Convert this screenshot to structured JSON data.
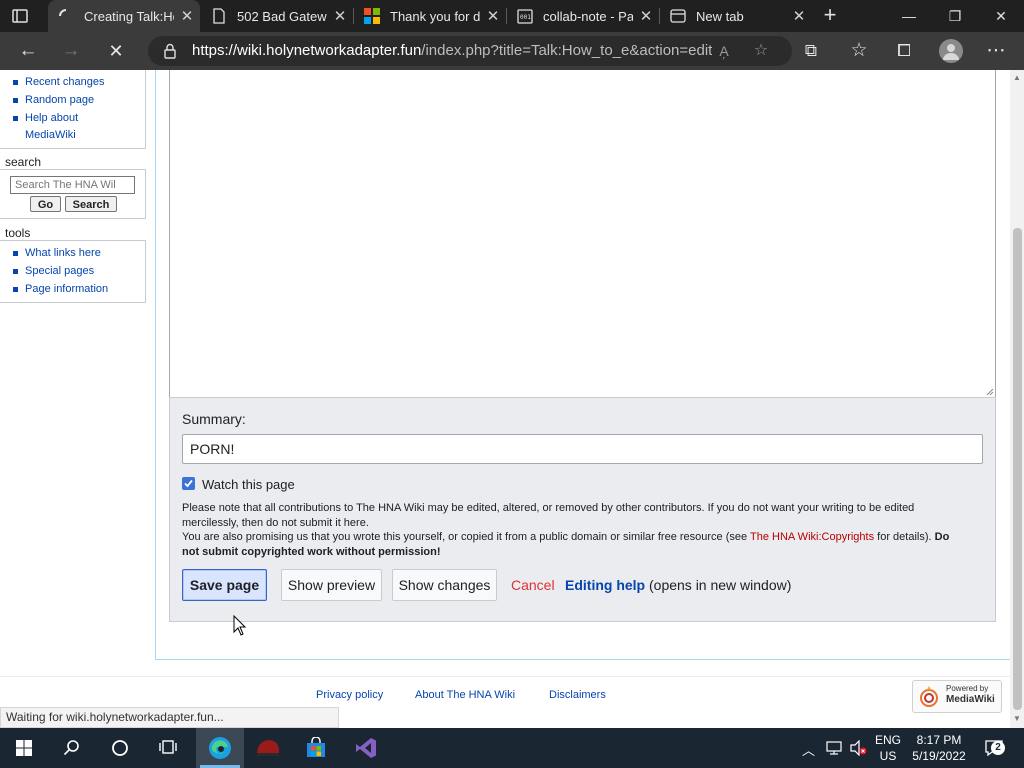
{
  "browser": {
    "tabs": [
      {
        "title": "Creating Talk:Ho",
        "active": true,
        "icon": "loading-spinner-icon"
      },
      {
        "title": "502 Bad Gatewa",
        "active": false,
        "icon": "page-icon"
      },
      {
        "title": "Thank you for d",
        "active": false,
        "icon": "microsoft-logo-icon"
      },
      {
        "title": "collab-note - Pa",
        "active": false,
        "icon": "binary-note-icon"
      },
      {
        "title": "New tab",
        "active": false,
        "icon": "new-tab-page-icon"
      }
    ],
    "url_host": "https://wiki.holynetworkadapter.fun",
    "url_path": "/index.php?title=Talk:How_to_e&action=edit..."
  },
  "sidebar": {
    "navigation_items": [
      "Recent changes",
      "Random page",
      "Help about",
      "MediaWiki"
    ],
    "search": {
      "heading": "search",
      "placeholder": "Search The HNA Wil",
      "go_label": "Go",
      "search_label": "Search"
    },
    "tools": {
      "heading": "tools",
      "items": [
        "What links here",
        "Special pages",
        "Page information"
      ]
    }
  },
  "editor": {
    "summary_label": "Summary:",
    "summary_value": "PORN!",
    "watch_label": "Watch this page",
    "watch_checked": true,
    "notice_line1": "Please note that all contributions to The HNA Wiki may be edited, altered, or removed by other contributors. If you do not want your writing to be edited",
    "notice_line2": "mercilessly, then do not submit it here.",
    "notice_line3_pre": "You are also promising us that you wrote this yourself, or copied it from a public domain or similar free resource (see ",
    "notice_link": "The HNA Wiki:Copyrights",
    "notice_line3_post": " for details). ",
    "notice_bold_1": "Do",
    "notice_bold_2": "not submit copyrighted work without permission!",
    "save_label": "Save page",
    "preview_label": "Show preview",
    "changes_label": "Show changes",
    "cancel_label": "Cancel",
    "help_label": "Editing help",
    "help_suffix": "(opens in new window)"
  },
  "footer": {
    "links": [
      "Privacy policy",
      "About The HNA Wiki",
      "Disclaimers"
    ],
    "powered_small": "Powered by",
    "powered_big": "MediaWiki"
  },
  "status_text": "Waiting for wiki.holynetworkadapter.fun...",
  "taskbar": {
    "language": "ENG",
    "region": "US",
    "time": "8:17 PM",
    "date": "5/19/2022",
    "notification_count": "2"
  },
  "colors": {
    "link": "#0645ad",
    "cancel_red": "#d33",
    "copyright_link": "#ba0000",
    "taskbar": "#1b2633"
  }
}
